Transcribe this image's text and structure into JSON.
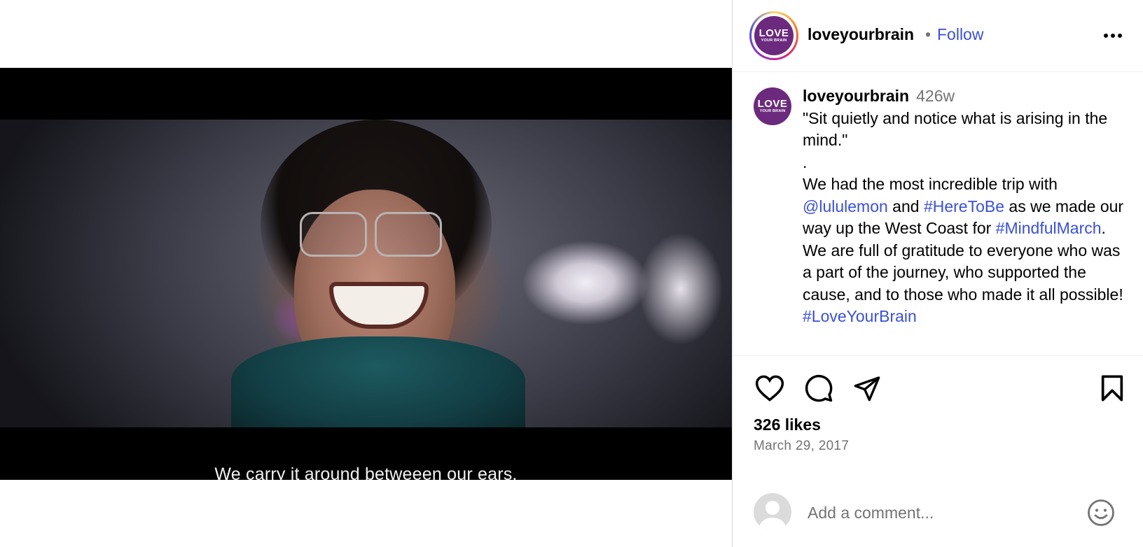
{
  "video": {
    "subtitle": "We carry it around betweeen our ears.",
    "mute_icon": "speaker-muted-icon"
  },
  "header": {
    "avatar_text_line1": "LOVE",
    "avatar_text_line2": "YOUR BRAIN",
    "username": "loveyourbrain",
    "separator": "•",
    "follow_label": "Follow",
    "more_icon": "more-options-icon"
  },
  "caption": {
    "username": "loveyourbrain",
    "time_ago": "426w",
    "quote": "\"Sit quietly and notice what is arising in the mind.\"",
    "dot": ".",
    "text_1": "We had the most incredible trip with ",
    "mention": "@lululemon",
    "text_2": " and ",
    "hashtag_1": "#HereToBe",
    "text_3": " as we made our way up the West Coast for ",
    "hashtag_2": "#MindfulMarch",
    "text_4": ". We are full of gratitude to everyone who was a part of the journey, who supported the cause, and to those who made it all possible! ",
    "hashtag_3": "#LoveYourBrain"
  },
  "actions": {
    "like_icon": "heart-icon",
    "comment_icon": "comment-icon",
    "share_icon": "share-icon",
    "save_icon": "bookmark-icon"
  },
  "likes": "326 likes",
  "date": "March 29, 2017",
  "comment": {
    "placeholder": "Add a comment...",
    "emoji_icon": "emoji-icon"
  },
  "colors": {
    "link": "#3a50d9",
    "muted": "#737373",
    "brand": "#6b2a7d"
  }
}
